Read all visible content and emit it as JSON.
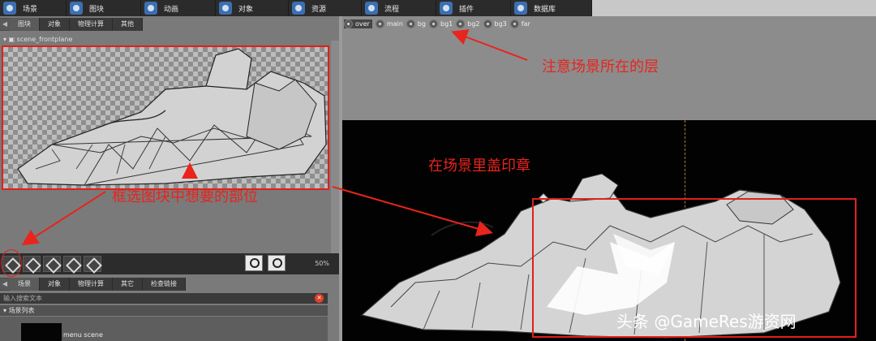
{
  "top_tabs": [
    {
      "label": "场景",
      "icon": "scene-icon"
    },
    {
      "label": "图块",
      "icon": "tile-icon"
    },
    {
      "label": "动画",
      "icon": "animation-icon"
    },
    {
      "label": "对象",
      "icon": "object-icon"
    },
    {
      "label": "资源",
      "icon": "resource-icon"
    },
    {
      "label": "流程",
      "icon": "flow-icon"
    },
    {
      "label": "插件",
      "icon": "plugin-icon"
    },
    {
      "label": "数据库",
      "icon": "database-icon"
    }
  ],
  "left_top_tabs": [
    "图块",
    "对象",
    "物理计算",
    "其他"
  ],
  "tile_name": "scene_frontplane",
  "zoom_level": "50%",
  "left_bottom_tabs": [
    "场景",
    "对象",
    "物理计算",
    "其它",
    "检查链接"
  ],
  "search": {
    "placeholder": "输入搜索文本"
  },
  "scene_list": {
    "header": "场景列表",
    "items": [
      "menu scene"
    ]
  },
  "layers": [
    "over",
    "main",
    "bg",
    "bg1",
    "bg2",
    "bg3",
    "far"
  ],
  "active_layer": "over",
  "annotations": {
    "layer_note": "注意场景所在的层",
    "stamp_note": "在场景里盖印章",
    "select_note": "框选图块中想要的部位"
  },
  "watermark": "头条 @GameRes游资网",
  "colors": {
    "annotation": "#e8241d",
    "stage": "#020202"
  }
}
